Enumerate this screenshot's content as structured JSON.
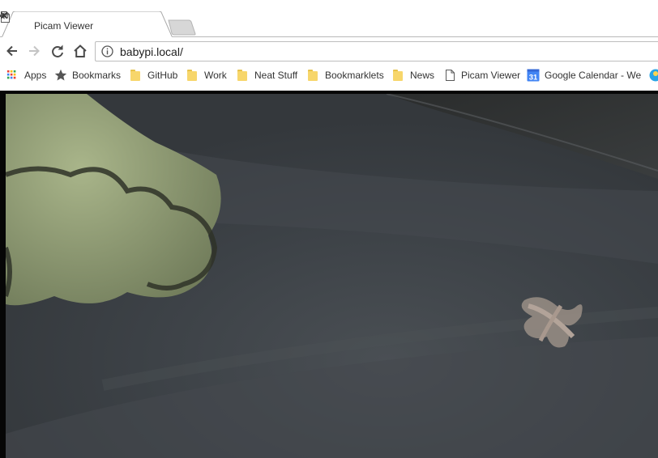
{
  "window": {
    "tabs": [
      {
        "title": "Picam Viewer",
        "active": true,
        "audio": true
      }
    ]
  },
  "toolbar": {
    "url": "babypi.local/"
  },
  "bookmarks": [
    {
      "label": "Apps",
      "icon": "apps-grid-icon"
    },
    {
      "label": "Bookmarks",
      "icon": "star-icon"
    },
    {
      "label": "GitHub",
      "icon": "folder-icon"
    },
    {
      "label": "Work",
      "icon": "folder-icon"
    },
    {
      "label": "Neat Stuff",
      "icon": "folder-icon"
    },
    {
      "label": "Bookmarklets",
      "icon": "folder-icon"
    },
    {
      "label": "News",
      "icon": "folder-icon"
    },
    {
      "label": "Picam Viewer",
      "icon": "page-icon"
    },
    {
      "label": "Google Calendar - We",
      "icon": "calendar-icon",
      "icon_text": "31"
    }
  ],
  "colors": {
    "folder": "#f7d66b",
    "calendar": "#4285f4",
    "video_background": "#3d4247"
  }
}
